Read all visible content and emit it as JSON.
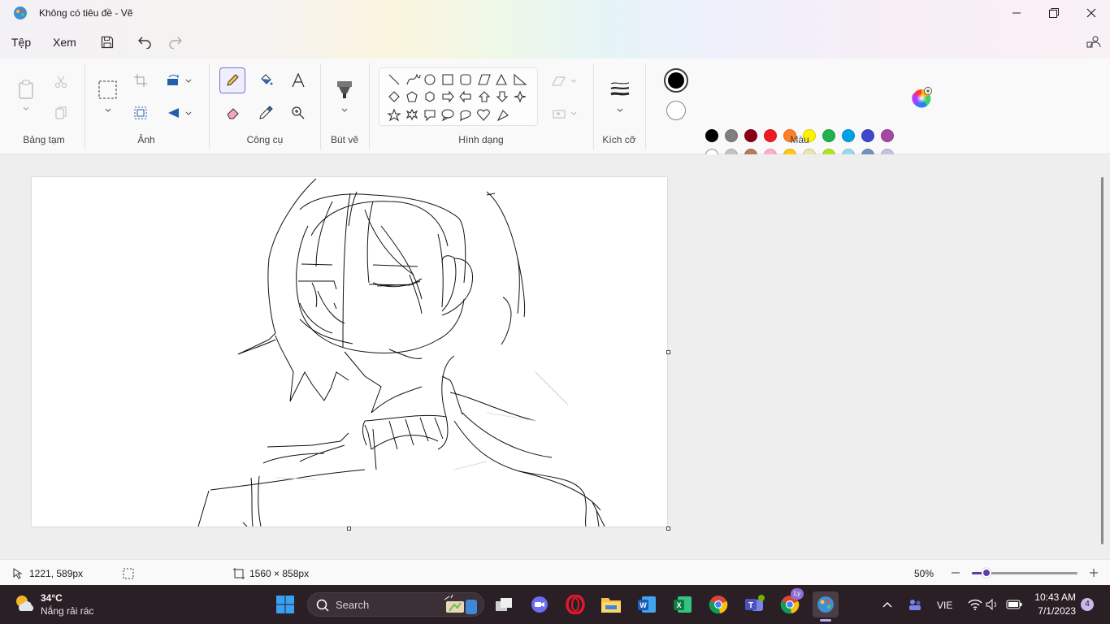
{
  "window": {
    "title": "Không có tiêu đề - Vẽ"
  },
  "menu": {
    "file": "Tệp",
    "view": "Xem"
  },
  "ribbon": {
    "groups": {
      "clipboard": "Bảng tạm",
      "image": "Ảnh",
      "tools": "Công cụ",
      "brushes": "Bút vẽ",
      "shapes": "Hình dạng",
      "size": "Kích cỡ",
      "colors": "Màu"
    },
    "primary_color": "#000000",
    "secondary_color": "#ffffff",
    "palette_row1": [
      "#000000",
      "#7f7f7f",
      "#880015",
      "#ed1c24",
      "#ff7f27",
      "#fff200",
      "#22b14c",
      "#00a2e8",
      "#3f48cc",
      "#a349a4"
    ],
    "palette_row2": [
      "#ffffff",
      "#c3c3c3",
      "#b97a57",
      "#ffaec9",
      "#ffc90e",
      "#efe4b0",
      "#b5e61d",
      "#99d9ea",
      "#7092be",
      "#c8bfe7"
    ]
  },
  "status": {
    "cursor_pos": "1221, 589px",
    "canvas_size": "1560 × 858px",
    "zoom": "50%",
    "zoom_level": 0.14
  },
  "taskbar": {
    "weather_temp": "34°C",
    "weather_desc": "Nắng rải rác",
    "search_placeholder": "Search",
    "language": "VIE",
    "time": "10:43 AM",
    "date": "7/1/2023",
    "notifications": "4",
    "chrome_badge": "Ly"
  }
}
